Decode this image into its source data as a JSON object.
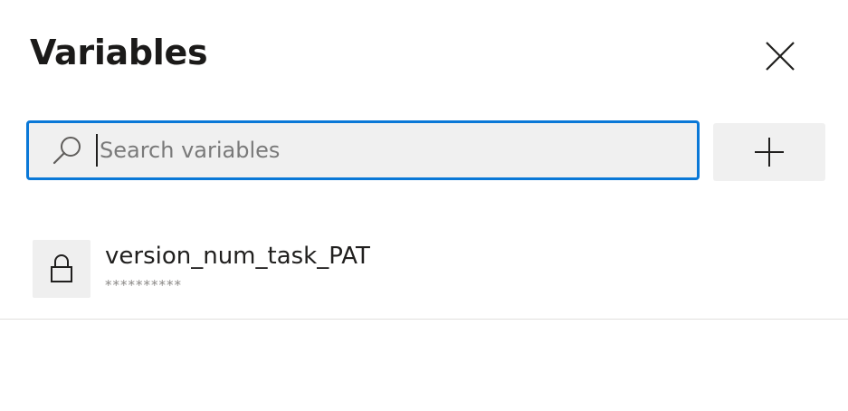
{
  "panel": {
    "title": "Variables"
  },
  "header": {
    "close_icon": "close-icon"
  },
  "search": {
    "placeholder": "Search variables",
    "value": "",
    "icon": "search-icon"
  },
  "toolbar": {
    "add_icon": "plus-icon"
  },
  "variables": [
    {
      "name": "version_num_task_PAT",
      "value": "**********",
      "icon": "lock-icon",
      "secret": true
    }
  ],
  "colors": {
    "focus_border": "#0a78d7",
    "field_background": "#f0f0f0",
    "masked_value": "#8a8886"
  }
}
